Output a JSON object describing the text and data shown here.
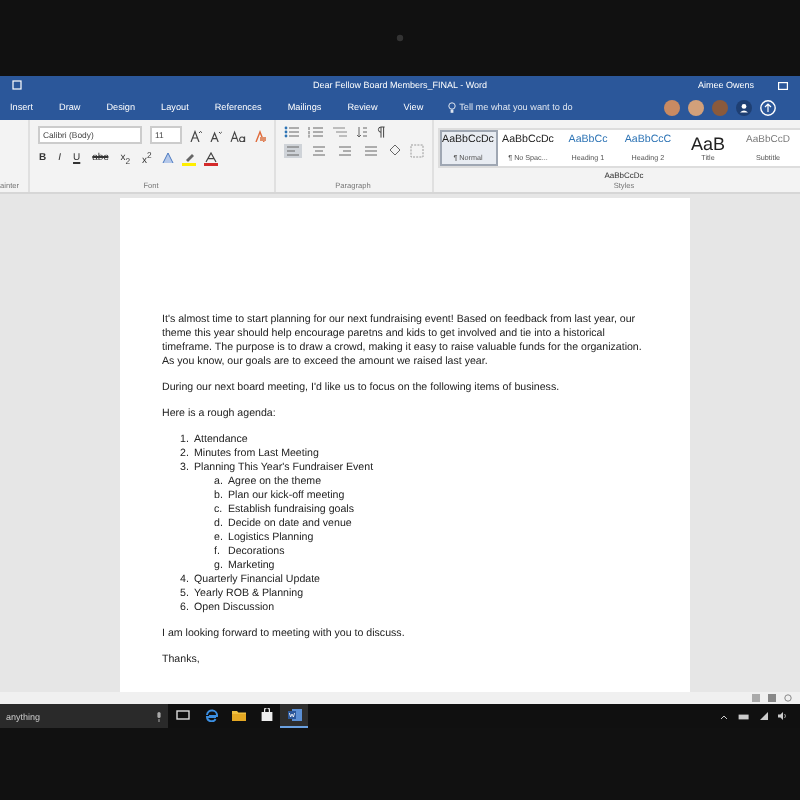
{
  "title_bar": {
    "title": "Dear Fellow Board Members_FINAL - Word",
    "user": "Aimee Owens"
  },
  "tabs": [
    {
      "label": "Insert",
      "selected": false
    },
    {
      "label": "Draw",
      "selected": false
    },
    {
      "label": "Design",
      "selected": false
    },
    {
      "label": "Layout",
      "selected": false
    },
    {
      "label": "References",
      "selected": false
    },
    {
      "label": "Mailings",
      "selected": false
    },
    {
      "label": "Review",
      "selected": false
    },
    {
      "label": "View",
      "selected": false
    }
  ],
  "tell_me": {
    "placeholder": "Tell me what you want to do"
  },
  "ribbon": {
    "clipboard_label": "ainter",
    "font": {
      "name": "Calibri (Body)",
      "size": "11",
      "format_buttons": [
        "B",
        "I",
        "U",
        "abc",
        "x$_{2}$",
        "x$^{2}$"
      ],
      "label": "Font"
    },
    "paragraph_label": "Paragraph",
    "styles": [
      {
        "sample": "AaBbCcDc",
        "name": "¶ Normal",
        "kind": "body",
        "selected": true
      },
      {
        "sample": "AaBbCcDc",
        "name": "¶ No Spac...",
        "kind": "body",
        "selected": false
      },
      {
        "sample": "AaBbCc",
        "name": "Heading 1",
        "kind": "heading",
        "selected": false
      },
      {
        "sample": "AaBbCcC",
        "name": "Heading 2",
        "kind": "heading",
        "selected": false
      },
      {
        "sample": "AaB",
        "name": "Title",
        "kind": "title",
        "selected": false
      },
      {
        "sample": "AaBbCcD",
        "name": "Subtitle",
        "kind": "subtitle",
        "selected": false
      }
    ],
    "styles_extra": "AaBbCcDc",
    "styles_label": "Styles"
  },
  "document": {
    "paragraphs": [
      "It's almost time to start planning for our next fundraising event! Based on feedback from last year, our theme this year should help encourage paretns and kids to get involved and tie into a historical timeframe. The purpose is to draw a crowd, making it easy to raise valuable funds for the organization. As you know, our goals are to exceed the amount we raised last year.",
      "During our next board meeting, I'd like us to focus on the following items of business.",
      "Here is a rough agenda:"
    ],
    "agenda": [
      {
        "marker": "1.",
        "text": "Attendance"
      },
      {
        "marker": "2.",
        "text": "Minutes from Last Meeting"
      },
      {
        "marker": "3.",
        "text": "Planning This Year's Fundraiser Event",
        "children": [
          {
            "marker": "a.",
            "text": "Agree on the theme"
          },
          {
            "marker": "b.",
            "text": "Plan our kick-off meeting"
          },
          {
            "marker": "c.",
            "text": "Establish fundraising goals"
          },
          {
            "marker": "d.",
            "text": "Decide on date and venue"
          },
          {
            "marker": "e.",
            "text": "Logistics Planning"
          },
          {
            "marker": "f.",
            "text": "Decorations"
          },
          {
            "marker": "g.",
            "text": "Marketing"
          }
        ]
      },
      {
        "marker": "4.",
        "text": "Quarterly Financial Update"
      },
      {
        "marker": "5.",
        "text": "Yearly ROB & Planning"
      },
      {
        "marker": "6.",
        "text": "Open Discussion"
      }
    ],
    "closing": [
      "I am looking forward to meeting with you to discuss.",
      "Thanks,"
    ]
  },
  "taskbar": {
    "search": {
      "value": "anything"
    },
    "apps": [
      {
        "kind": "taskview",
        "selected": false
      },
      {
        "kind": "edge",
        "selected": false
      },
      {
        "kind": "folder",
        "selected": false
      },
      {
        "kind": "store",
        "selected": false
      },
      {
        "kind": "word",
        "selected": true
      }
    ]
  }
}
